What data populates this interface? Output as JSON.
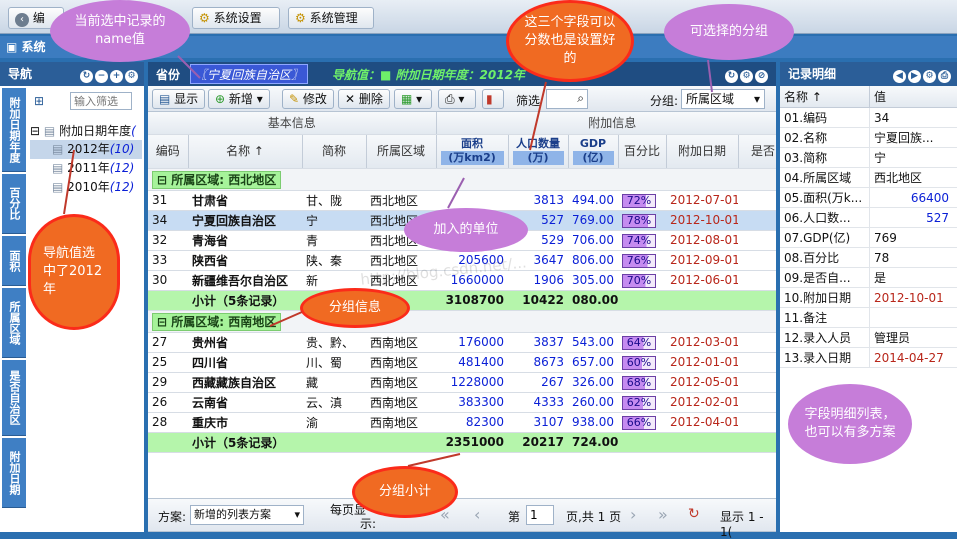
{
  "app": {
    "toolbar": {
      "edit": "编",
      "system_settings": "系统设置",
      "system_management": "系统管理",
      "hidden": "▾"
    },
    "tab": "系统",
    "colors": {
      "accent": "#2b5e98",
      "group_green": "#a6f39a",
      "callout_purple": "#c67dd9",
      "callout_orange": "#f06a22"
    }
  },
  "nav": {
    "title": "导航",
    "search_placeholder": "输入筛选",
    "vtabs": [
      "附加日期年度",
      "百分比",
      "面积",
      "所属区域",
      "是否自治区",
      "附加日期"
    ],
    "tree": {
      "root": "附加日期年度",
      "root_count": "(",
      "items": [
        {
          "label": "2012年",
          "count": "(10)"
        },
        {
          "label": "2011年",
          "count": "(12)"
        },
        {
          "label": "2010年",
          "count": "(12)"
        }
      ]
    }
  },
  "main": {
    "province_label": "省份",
    "province_value": "〖宁夏回族自治区〗",
    "nav_value": "导航值：■ 附加日期年度：2012年",
    "toolbar": {
      "display": "显示",
      "add": "新增",
      "edit": "修改",
      "delete": "删除",
      "filter": "筛选",
      "group_label": "分组:",
      "group_value": "所属区域"
    },
    "header_groups": {
      "basic": "基本信息",
      "extra": "附加信息"
    },
    "columns": [
      "编码",
      "名称 ↑",
      "简称",
      "所属区域",
      "面积",
      "(万km2)",
      "人口数量",
      "(万)",
      "GDP",
      "(亿)",
      "百分比",
      "附加日期",
      "是否"
    ],
    "groups": [
      {
        "label": "所属区域: 西北地区",
        "rows": [
          {
            "code": "31",
            "name": "甘肃省",
            "short": "甘、陇",
            "region": "西北地区",
            "area": "",
            "pop": "3813",
            "gdp": "494.00",
            "pct": "72%",
            "pct_val": 72,
            "date": "2012-07-01"
          },
          {
            "code": "34",
            "name": "宁夏回族自治区",
            "short": "宁",
            "region": "西北地区",
            "area": "",
            "pop": "527",
            "gdp": "769.00",
            "pct": "78%",
            "pct_val": 78,
            "date": "2012-10-01"
          },
          {
            "code": "32",
            "name": "青海省",
            "short": "青",
            "region": "西北地区",
            "area": "",
            "pop": "529",
            "gdp": "706.00",
            "pct": "74%",
            "pct_val": 74,
            "date": "2012-08-01"
          },
          {
            "code": "33",
            "name": "陕西省",
            "short": "陕、秦",
            "region": "西北地区",
            "area": "205600",
            "pop": "3647",
            "gdp": "806.00",
            "pct": "76%",
            "pct_val": 76,
            "date": "2012-09-01"
          },
          {
            "code": "30",
            "name": "新疆维吾尔自治区",
            "short": "新",
            "region": "西北地区",
            "area": "1660000",
            "pop": "1906",
            "gdp": "305.00",
            "pct": "70%",
            "pct_val": 70,
            "date": "2012-06-01"
          }
        ],
        "subtotal": {
          "label": "小计（5条记录）",
          "area": "3108700",
          "pop": "10422",
          "gdp": "080.00"
        }
      },
      {
        "label": "所属区域: 西南地区",
        "rows": [
          {
            "code": "27",
            "name": "贵州省",
            "short": "贵、黔、",
            "region": "西南地区",
            "area": "176000",
            "pop": "3837",
            "gdp": "543.00",
            "pct": "64%",
            "pct_val": 64,
            "date": "2012-03-01"
          },
          {
            "code": "25",
            "name": "四川省",
            "short": "川、蜀",
            "region": "西南地区",
            "area": "481400",
            "pop": "8673",
            "gdp": "657.00",
            "pct": "60%",
            "pct_val": 60,
            "date": "2012-01-01"
          },
          {
            "code": "29",
            "name": "西藏藏族自治区",
            "short": "藏",
            "region": "西南地区",
            "area": "1228000",
            "pop": "267",
            "gdp": "326.00",
            "pct": "68%",
            "pct_val": 68,
            "date": "2012-05-01"
          },
          {
            "code": "26",
            "name": "云南省",
            "short": "云、滇",
            "region": "西南地区",
            "area": "383300",
            "pop": "4333",
            "gdp": "260.00",
            "pct": "62%",
            "pct_val": 62,
            "date": "2012-02-01"
          },
          {
            "code": "28",
            "name": "重庆市",
            "short": "渝",
            "region": "西南地区",
            "area": "82300",
            "pop": "3107",
            "gdp": "938.00",
            "pct": "66%",
            "pct_val": 66,
            "date": "2012-04-01"
          }
        ],
        "subtotal": {
          "label": "小计（5条记录）",
          "area": "2351000",
          "pop": "20217",
          "gdp": "724.00"
        }
      }
    ],
    "footer": {
      "scheme_label": "方案:",
      "scheme_value": "新增的列表方案",
      "per_page": "每页显",
      "show": "示:",
      "page_label": "第",
      "page_value": "1",
      "page_total": "页,共 1 页",
      "display": "显示 1 - 1("
    }
  },
  "record": {
    "title": "记录明细",
    "col_name": "名称 ↑",
    "col_value": "值",
    "rows": [
      {
        "k": "01.编码",
        "v": "34"
      },
      {
        "k": "02.名称",
        "v": "宁夏回族..."
      },
      {
        "k": "03.简称",
        "v": "宁"
      },
      {
        "k": "04.所属区域",
        "v": "西北地区"
      },
      {
        "k": "05.面积(万k...",
        "v": "66400"
      },
      {
        "k": "06.人口数...",
        "v": "527"
      },
      {
        "k": "07.GDP(亿)",
        "v": "769"
      },
      {
        "k": "08.百分比",
        "v": "78"
      },
      {
        "k": "09.是否自...",
        "v": "是"
      },
      {
        "k": "10.附加日期",
        "v": "2012-10-01"
      },
      {
        "k": "11.备注",
        "v": ""
      },
      {
        "k": "12.录入人员",
        "v": "管理员"
      },
      {
        "k": "13.录入日期",
        "v": "2014-04-27"
      }
    ]
  },
  "annotations": {
    "current_record": "当前选中记录的name值",
    "score_fields": "这三个字段可以分数也是设置好的",
    "group_choice": "可选择的分组",
    "nav_selected": "导航值选中了2012年",
    "units": "加入的单位",
    "group_info": "分组信息",
    "group_subtotal": "分组小计",
    "field_detail": "字段明细列表，也可以有多方案"
  },
  "watermark": "http://blog.csdn.net/..."
}
